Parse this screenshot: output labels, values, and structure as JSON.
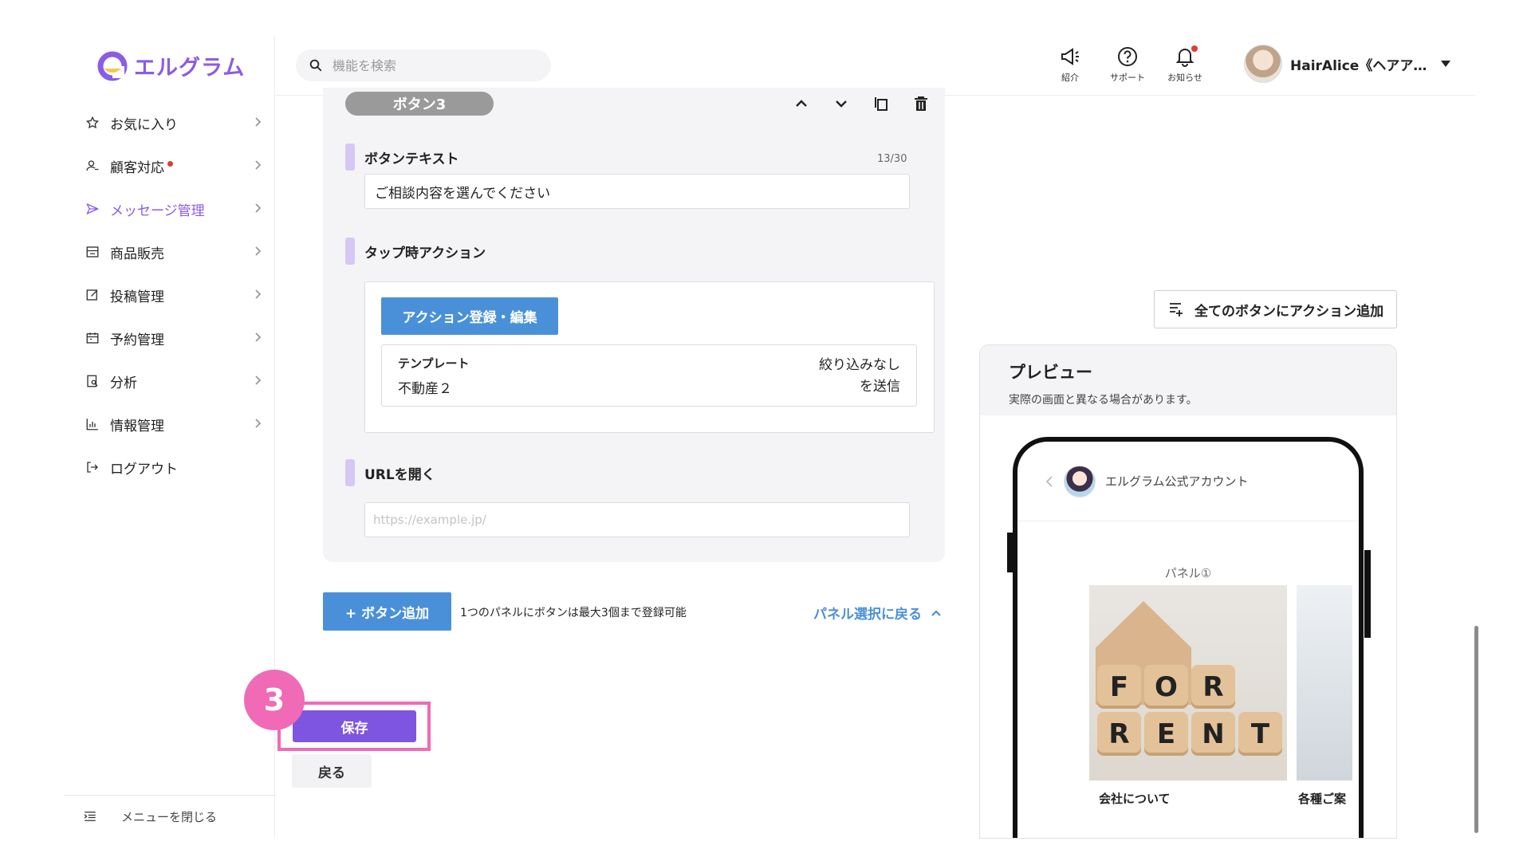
{
  "brand": {
    "name": "エルグラム",
    "color": "#8a5ce8"
  },
  "search": {
    "placeholder": "機能を検索"
  },
  "sidebar": {
    "items": [
      {
        "label": "お気に入り",
        "icon": "star-icon"
      },
      {
        "label": "顧客対応",
        "icon": "user-icon",
        "badge": true
      },
      {
        "label": "メッセージ管理",
        "icon": "send-icon",
        "active": true
      },
      {
        "label": "商品販売",
        "icon": "shop-icon"
      },
      {
        "label": "投稿管理",
        "icon": "edit-icon"
      },
      {
        "label": "予約管理",
        "icon": "calendar-icon"
      },
      {
        "label": "分析",
        "icon": "analysis-icon"
      },
      {
        "label": "情報管理",
        "icon": "chart-icon"
      },
      {
        "label": "ログアウト",
        "icon": "logout-icon"
      }
    ],
    "close_menu_label": "メニューを閉じる"
  },
  "topbar": {
    "icons": [
      {
        "label": "紹介",
        "icon": "megaphone-icon"
      },
      {
        "label": "サポート",
        "icon": "help-icon"
      },
      {
        "label": "お知らせ",
        "icon": "bell-icon"
      }
    ],
    "user_name": "HairAlice《ヘアア…"
  },
  "editor": {
    "button_title": "ボタン3",
    "button_text_label": "ボタンテキスト",
    "button_text_counter": "13/30",
    "button_text_value": "ご相談内容を選んでください",
    "tap_action_label": "タップ時アクション",
    "action_register_label": "アクション登録・編集",
    "template_label": "テンプレート",
    "template_name": "不動産２",
    "template_filter_line1": "絞り込みなし",
    "template_filter_line2": "を送信",
    "url_label": "URLを開く",
    "url_placeholder": "https://example.jp/",
    "add_button_label": "+ ボタン追加",
    "add_button_note": "1つのパネルにボタンは最大3個まで登録可能",
    "back_to_panel_label": "パネル選択に戻る"
  },
  "actions": {
    "step_number": "3",
    "save_label": "保存",
    "back_label": "戻る",
    "highlight_color": "#f06ab6"
  },
  "preview": {
    "add_all_action_label": "全てのボタンにアクション追加",
    "title": "プレビュー",
    "subtitle": "実際の画面と異なる場合があります。",
    "account_name": "エルグラム公式アカウント",
    "panel_label": "パネル①",
    "blocks_row1": [
      "F",
      "O",
      "R"
    ],
    "blocks_row2": [
      "R",
      "E",
      "N",
      "T"
    ],
    "panel_caption": "会社について",
    "panel_caption2": "各種ご案"
  }
}
